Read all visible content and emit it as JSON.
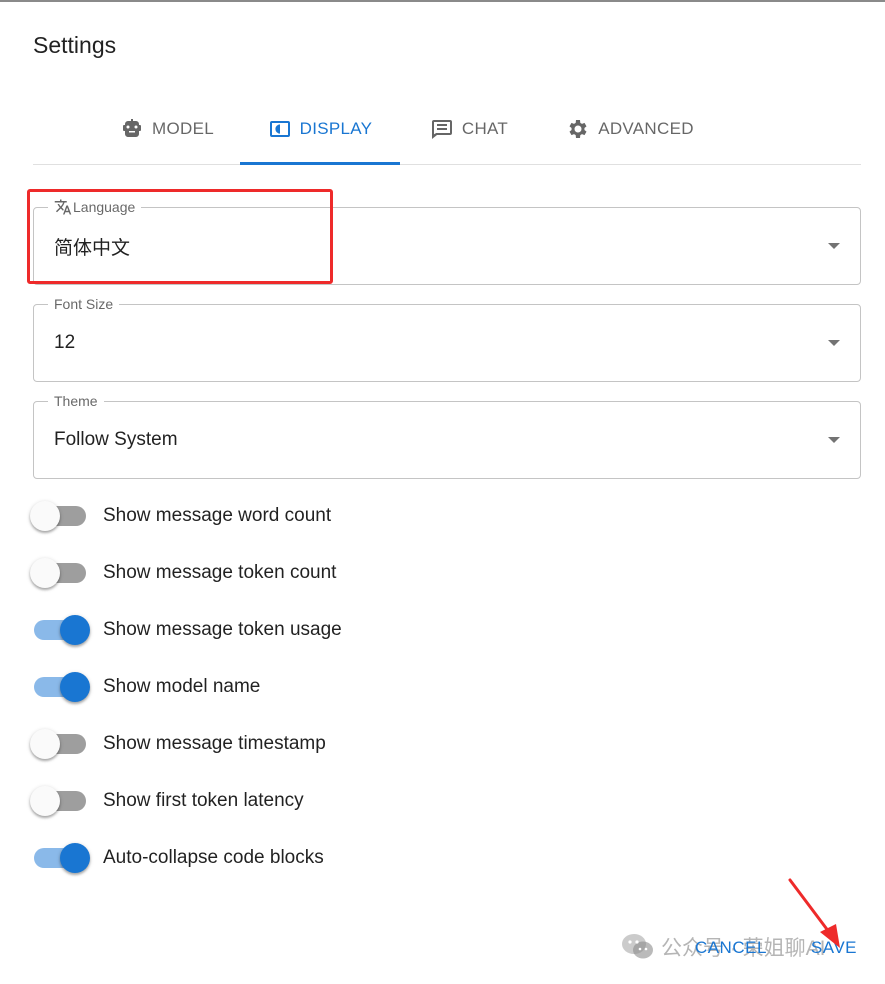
{
  "dialog": {
    "title": "Settings"
  },
  "tabs": [
    {
      "label": "MODEL",
      "icon": "robot-icon",
      "active": false
    },
    {
      "label": "DISPLAY",
      "icon": "display-icon",
      "active": true
    },
    {
      "label": "CHAT",
      "icon": "chat-icon",
      "active": false
    },
    {
      "label": "ADVANCED",
      "icon": "gear-icon",
      "active": false
    }
  ],
  "fields": {
    "language": {
      "label": "Language",
      "icon": "translate-icon",
      "value": "简体中文"
    },
    "font_size": {
      "label": "Font Size",
      "value": "12"
    },
    "theme": {
      "label": "Theme",
      "value": "Follow System"
    }
  },
  "switches": [
    {
      "label": "Show message word count",
      "checked": false
    },
    {
      "label": "Show message token count",
      "checked": false
    },
    {
      "label": "Show message token usage",
      "checked": true
    },
    {
      "label": "Show model name",
      "checked": true
    },
    {
      "label": "Show message timestamp",
      "checked": false
    },
    {
      "label": "Show first token latency",
      "checked": false
    },
    {
      "label": "Auto-collapse code blocks",
      "checked": true
    }
  ],
  "actions": {
    "cancel_label": "CANCEL",
    "save_label": "SAVE"
  },
  "watermark": {
    "text": "公众号 · 荣姐聊AI",
    "icon": "wechat-icon"
  },
  "colors": {
    "primary": "#1976d2",
    "highlight": "#ee2a2a"
  }
}
